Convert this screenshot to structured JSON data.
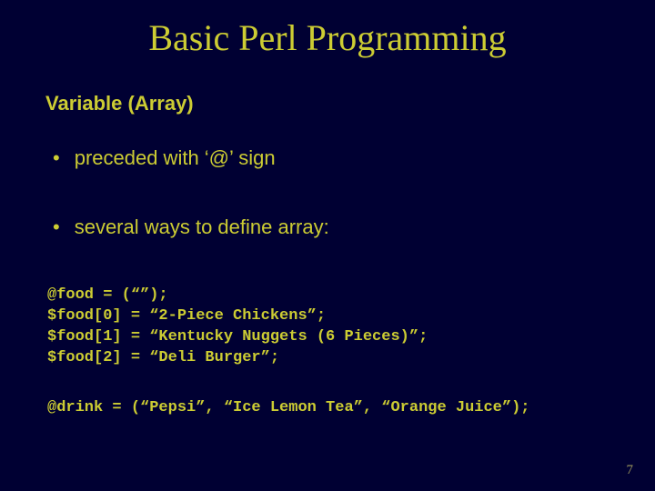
{
  "title": "Basic Perl Programming",
  "subtitle": "Variable (Array)",
  "bullets": [
    "preceded with ‘@’ sign",
    "several ways to define array:"
  ],
  "code1": "@food = (“”);\n$food[0] = “2-Piece Chickens”;\n$food[1] = “Kentucky Nuggets (6 Pieces)”;\n$food[2] = “Deli Burger”;",
  "code2": "@drink = (“Pepsi”, “Ice Lemon Tea”, “Orange Juice”);",
  "page_number": "7"
}
